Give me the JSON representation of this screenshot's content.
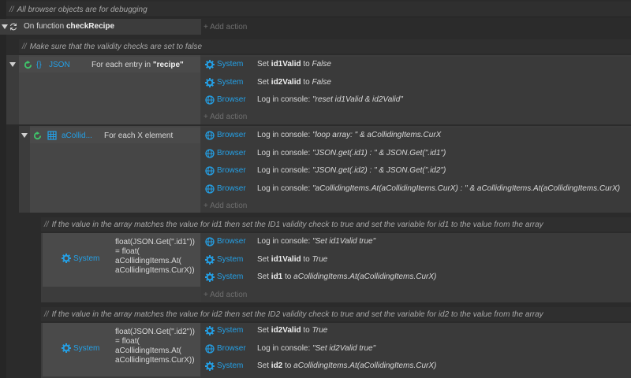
{
  "comments": {
    "top": "All browser objects are for debugging",
    "validity": "Make sure that the validity checks are set to false",
    "id1": "If the value in the array matches the value for id1 then set the ID1 validity check to true and set the variable for id1 to the value from the array",
    "id2": "If the value in the array matches the value for id2 then set the ID2 validity check to true and set the variable for id2 to the value from the array"
  },
  "function_event": {
    "prefix": "On function",
    "name": "checkRecipe",
    "add_action": "+ Add action"
  },
  "json_event": {
    "object": "JSON",
    "condition_prefix": "For each entry in",
    "condition_value": "\"recipe\"",
    "add_action": "+ Add action",
    "actions": [
      {
        "object": "System",
        "pre": "Set ",
        "bold": "id1Valid",
        "mid": " to ",
        "ital": "False"
      },
      {
        "object": "System",
        "pre": "Set ",
        "bold": "id2Valid",
        "mid": " to ",
        "ital": "False"
      },
      {
        "object": "Browser",
        "pre": "Log in console: ",
        "bold": "",
        "mid": "",
        "ital": "\"reset id1Valid & id2Valid\""
      }
    ]
  },
  "array_event": {
    "object": "aCollid...",
    "condition": "For each X element",
    "add_action": "+ Add action",
    "actions": [
      {
        "object": "Browser",
        "pre": "Log in console: ",
        "ital": "\"loop array: \" & aCollidingItems.CurX"
      },
      {
        "object": "Browser",
        "pre": "Log in console: ",
        "ital": "\"JSON.get(.id1) : \" & JSON.Get(\".id1\")"
      },
      {
        "object": "Browser",
        "pre": "Log in console: ",
        "ital": "\"JSON.get(.id2) : \" & JSON.Get(\".id2\")"
      },
      {
        "object": "Browser",
        "pre": "Log in console: ",
        "ital": "\"aCollidingItems.At(aCollidingItems.CurX) : \" & aCollidingItems.At(aCollidingItems.CurX)"
      }
    ]
  },
  "id1_event": {
    "object": "System",
    "condition_lines": [
      "float(JSON.Get(\".id1\"))",
      "= float(",
      "aCollidingItems.At(",
      "aCollidingItems.CurX))"
    ],
    "add_action": "+ Add action",
    "actions": [
      {
        "object": "Browser",
        "pre": "Log in console: ",
        "bold": "",
        "mid": "",
        "ital": "\"Set id1Valid true\""
      },
      {
        "object": "System",
        "pre": "Set ",
        "bold": "id1Valid",
        "mid": " to ",
        "ital": "True"
      },
      {
        "object": "System",
        "pre": "Set ",
        "bold": "id1",
        "mid": " to ",
        "ital": "aCollidingItems.At(aCollidingItems.CurX)"
      }
    ]
  },
  "id2_event": {
    "object": "System",
    "condition_lines": [
      "float(JSON.Get(\".id2\"))",
      "= float(",
      "aCollidingItems.At(",
      "aCollidingItems.CurX))"
    ],
    "actions": [
      {
        "object": "System",
        "pre": "Set ",
        "bold": "id2Valid",
        "mid": " to ",
        "ital": "True"
      },
      {
        "object": "Browser",
        "pre": "Log in console: ",
        "bold": "",
        "mid": "",
        "ital": "\"Set id2Valid true\""
      },
      {
        "object": "System",
        "pre": "Set ",
        "bold": "id2",
        "mid": " to ",
        "ital": "aCollidingItems.At(aCollidingItems.CurX)"
      }
    ]
  },
  "colors": {
    "object_blue": "#24a0e6",
    "loop_green": "#3fc46a"
  }
}
